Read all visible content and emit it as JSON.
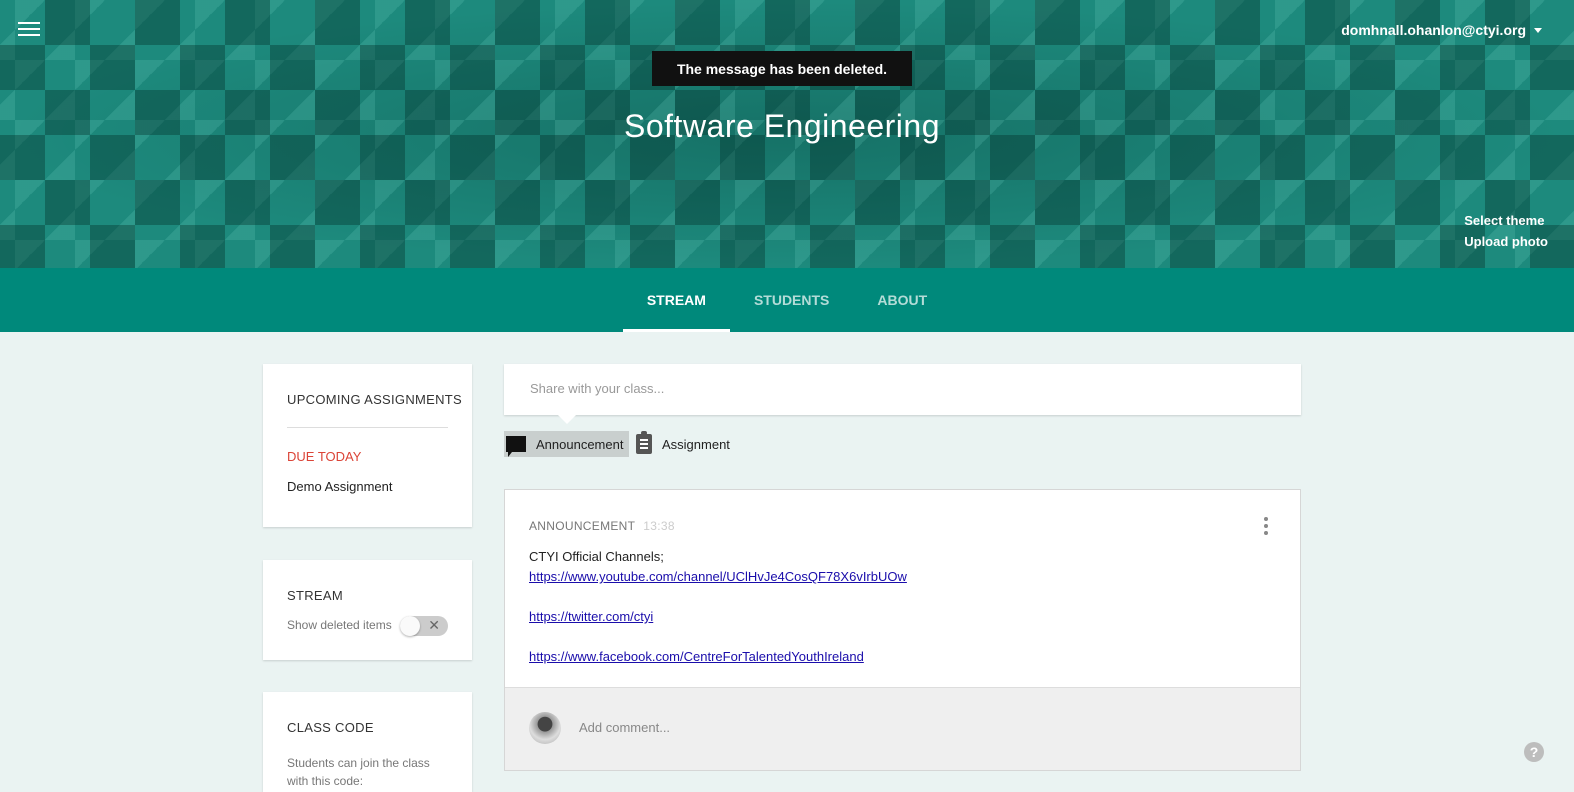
{
  "header": {
    "account_email": "domhnall.ohanlon@ctyi.org",
    "toast": "The message has been deleted.",
    "class_title": "Software Engineering",
    "select_theme": "Select theme",
    "upload_photo": "Upload photo",
    "accent_color": "#00897b"
  },
  "tabs": [
    {
      "label": "STREAM",
      "active": true
    },
    {
      "label": "STUDENTS",
      "active": false
    },
    {
      "label": "ABOUT",
      "active": false
    }
  ],
  "upcoming": {
    "heading": "UPCOMING ASSIGNMENTS",
    "due_label": "DUE TODAY",
    "item": "Demo Assignment"
  },
  "stream_panel": {
    "heading": "STREAM",
    "show_deleted": "Show deleted items",
    "toggle_on": false
  },
  "class_code": {
    "heading": "CLASS CODE",
    "text": "Students can join the class with this code:"
  },
  "share": {
    "placeholder": "Share with your class...",
    "announcement": "Announcement",
    "assignment": "Assignment"
  },
  "post": {
    "type": "ANNOUNCEMENT",
    "time": "13:38",
    "intro": "CTYI Official Channels;",
    "links": [
      "https://www.youtube.com/channel/UClHvJe4CosQF78X6vIrbUOw",
      "https://twitter.com/ctyi",
      "https://www.facebook.com/CentreForTalentedYouthIreland"
    ],
    "comment_placeholder": "Add comment..."
  },
  "help_label": "?"
}
